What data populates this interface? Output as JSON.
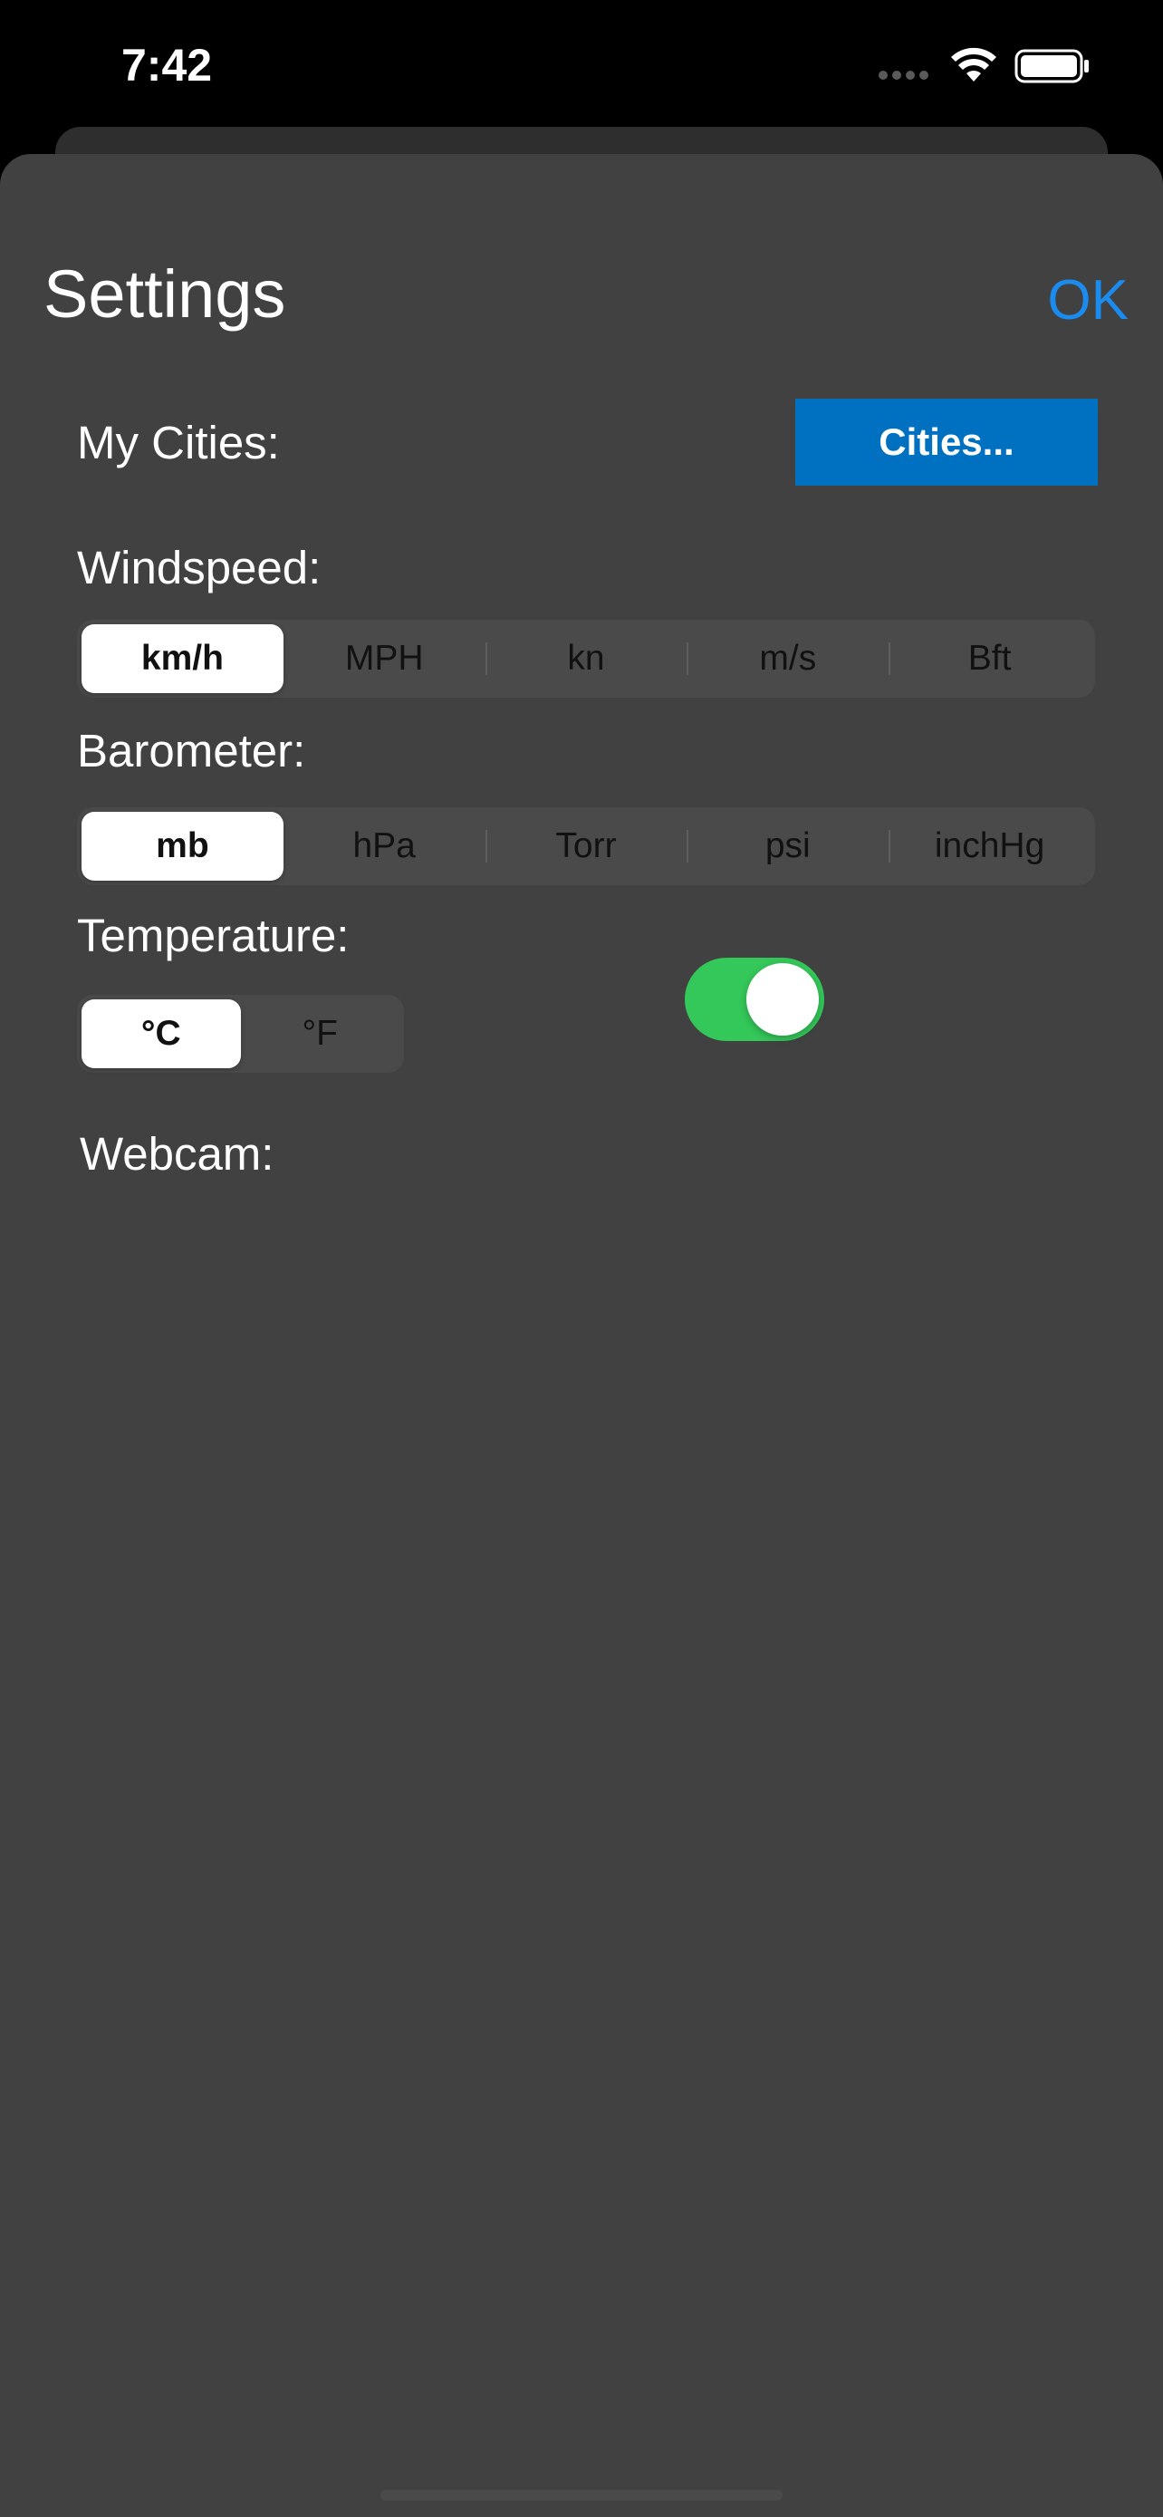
{
  "status_bar": {
    "time": "7:42",
    "signal_icon": "cellular-dots-icon",
    "wifi_icon": "wifi-icon",
    "battery_icon": "battery-full-icon"
  },
  "sheet": {
    "title": "Settings",
    "ok_label": "OK"
  },
  "settings": {
    "my_cities_label": "My Cities:",
    "cities_button_label": "Cities...",
    "windspeed_label": "Windspeed:",
    "windspeed_options": [
      "km/h",
      "MPH",
      "kn",
      "m/s",
      "Bft"
    ],
    "windspeed_selected": "km/h",
    "barometer_label": "Barometer:",
    "barometer_options": [
      "mb",
      "hPa",
      "Torr",
      "psi",
      "inchHg"
    ],
    "barometer_selected": "mb",
    "temperature_label": "Temperature:",
    "temperature_options": [
      "°C",
      "°F"
    ],
    "temperature_selected": "°C",
    "webcam_label": "Webcam:",
    "webcam_enabled": true
  },
  "colors": {
    "accent_blue": "#1a8cf0",
    "button_blue": "#0070c0",
    "toggle_green": "#34c759",
    "sheet_bg": "#414141"
  }
}
